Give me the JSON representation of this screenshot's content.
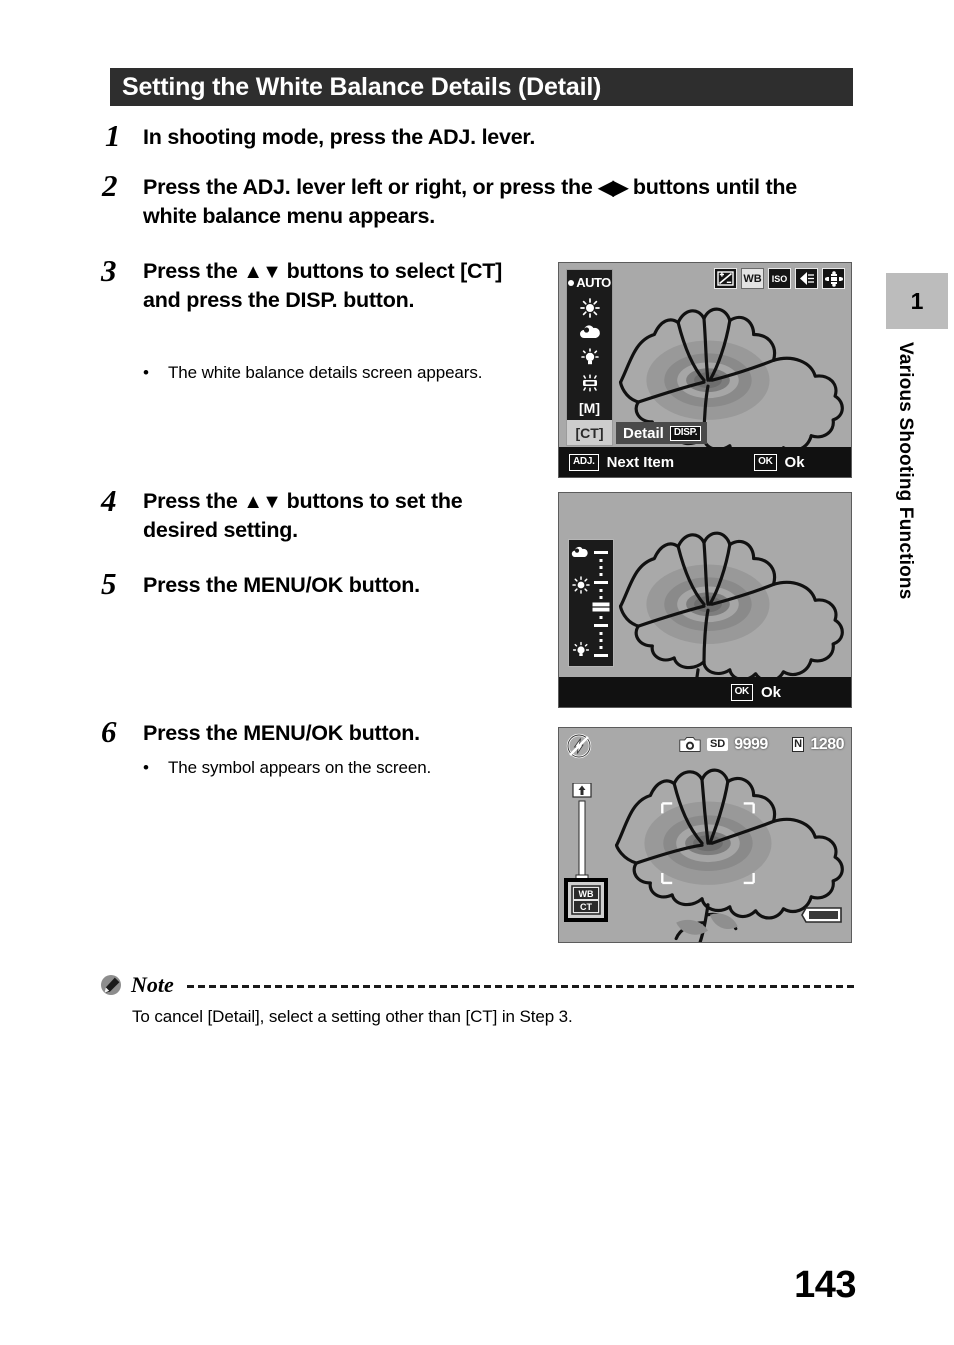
{
  "page": {
    "number": "143",
    "chapter_number": "1",
    "chapter_label": "Various Shooting Functions",
    "section_title": "Setting the White Balance Details (Detail)"
  },
  "steps": [
    {
      "number": "1",
      "text": "In shooting mode, press the ADJ. lever.",
      "bullet": ""
    },
    {
      "number": "2",
      "text_part1": "Press the ADJ. lever left or right, or press the ",
      "arrows": "◀▶",
      "text_part2": "buttons until the white balance menu appears.",
      "bullet": ""
    },
    {
      "number": "3",
      "text_part1": "Press the ",
      "arrows": "▲▼",
      "text_part2": " buttons to select [CT] and press the DISP. button.",
      "bullet": "The white balance details screen appears."
    },
    {
      "number": "4",
      "text_part1": "Press the ",
      "arrows": "▲▼",
      "text_part2": " buttons to set the desired setting.",
      "bullet": ""
    },
    {
      "number": "5",
      "text": "Press the MENU/OK button.",
      "bullet": ""
    },
    {
      "number": "6",
      "text": "Press the MENU/OK button.",
      "bullet": "The symbol appears on the screen."
    }
  ],
  "note": {
    "icon": "note-pen-icon",
    "title": "Note",
    "text": "To cancel [Detail], select a setting other than [CT] in Step 3."
  },
  "screen1": {
    "name": "white-balance-menu-screen",
    "wb_items": [
      {
        "icon": "auto-radio-icon",
        "label": "AUTO",
        "selected": false
      },
      {
        "icon": "daylight-sun-icon",
        "label": "",
        "selected": false
      },
      {
        "icon": "overcast-cloud-icon",
        "label": "",
        "selected": false
      },
      {
        "icon": "incandescent-lamp-icon",
        "label": "",
        "selected": false
      },
      {
        "icon": "fluorescent-tube-icon",
        "label": "",
        "selected": false
      },
      {
        "icon": "manual-icon",
        "label": "[M]",
        "selected": false
      },
      {
        "icon": "color-temperature-icon",
        "label": "[CT]",
        "selected": true
      }
    ],
    "top_icons": [
      {
        "name": "exposure-compensation-icon",
        "label": "±",
        "active": false
      },
      {
        "name": "white-balance-icon",
        "label": "WB",
        "active": true
      },
      {
        "name": "iso-icon",
        "label": "ISO",
        "active": false
      },
      {
        "name": "focus-icon",
        "label": "AF",
        "active": false
      },
      {
        "name": "adj-pad-icon",
        "label": "",
        "active": false
      }
    ],
    "detail_chip_label": "Detail",
    "detail_chip_key": "DISP.",
    "footer_left_key": "ADJ.",
    "footer_left_label": "Next Item",
    "footer_right_key": "OK",
    "footer_right_label": "Ok"
  },
  "screen2": {
    "name": "white-balance-details-screen",
    "slider_top_icon": "overcast-cloud-icon",
    "slider_mid_icon": "daylight-sun-icon",
    "slider_bottom_icon": "incandescent-lamp-icon",
    "footer_right_key": "OK",
    "footer_right_label": "Ok"
  },
  "screen3": {
    "name": "shooting-live-view-screen",
    "flash_icon": "flash-off-icon",
    "mode_icon": "still-camera-icon",
    "card_badge": "SD",
    "shots_remaining": "9999",
    "quality_badge": "N",
    "image_size": "1280",
    "zoom_top_icon": "telephoto-icon",
    "zoom_bottom_icon": "wide-angle-icon",
    "wb_badge_line1": "WB",
    "wb_badge_line2": "CT",
    "battery_icon": "battery-full-icon"
  }
}
